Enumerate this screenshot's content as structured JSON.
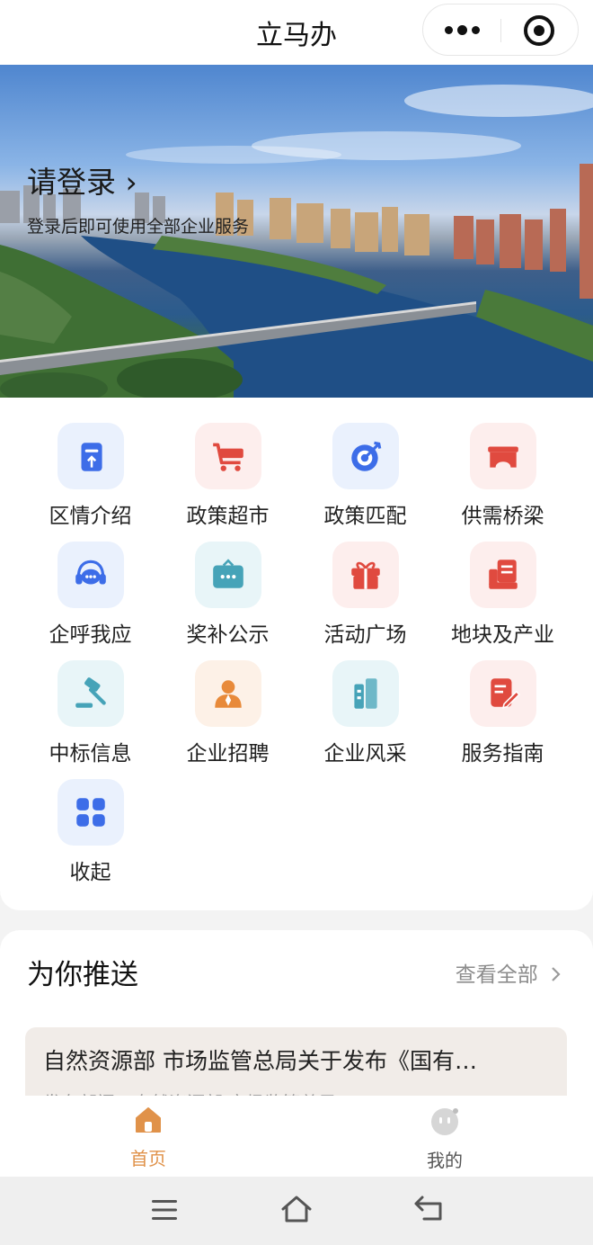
{
  "app": {
    "title": "立马办"
  },
  "hero": {
    "login_label": "请登录",
    "login_chevron": "›",
    "login_sub": "登录后即可使用全部企业服务"
  },
  "services": [
    {
      "label": "区情介绍",
      "icon": "document-upload-icon",
      "color": "#3d6de8",
      "bg": "#eaf1fd"
    },
    {
      "label": "政策超市",
      "icon": "shopping-cart-icon",
      "color": "#e04a3f",
      "bg": "#fdeeed"
    },
    {
      "label": "政策匹配",
      "icon": "target-dart-icon",
      "color": "#3d6de8",
      "bg": "#eaf1fd"
    },
    {
      "label": "供需桥梁",
      "icon": "bridge-icon",
      "color": "#e04a3f",
      "bg": "#fdeeed"
    },
    {
      "label": "企呼我应",
      "icon": "headset-chat-icon",
      "color": "#3d6de8",
      "bg": "#eaf1fd"
    },
    {
      "label": "奖补公示",
      "icon": "bulletin-board-icon",
      "color": "#46a3b8",
      "bg": "#e8f5f8"
    },
    {
      "label": "活动广场",
      "icon": "gift-icon",
      "color": "#e04a3f",
      "bg": "#fdeeed"
    },
    {
      "label": "地块及产业",
      "icon": "register-icon",
      "color": "#e04a3f",
      "bg": "#fdeeed"
    },
    {
      "label": "中标信息",
      "icon": "gavel-icon",
      "color": "#46a3b8",
      "bg": "#e8f5f8"
    },
    {
      "label": "企业招聘",
      "icon": "person-icon",
      "color": "#e88a3a",
      "bg": "#fdf1e7"
    },
    {
      "label": "企业风采",
      "icon": "buildings-icon",
      "color": "#46a3b8",
      "bg": "#e8f5f8"
    },
    {
      "label": "服务指南",
      "icon": "edit-document-icon",
      "color": "#e04a3f",
      "bg": "#fdeeed"
    },
    {
      "label": "收起",
      "icon": "grid-icon",
      "color": "#3d6de8",
      "bg": "#eaf1fd"
    }
  ],
  "recommend": {
    "title": "为你推送",
    "view_all": "查看全部",
    "items": [
      {
        "headline": "自然资源部 市场监管总局关于发布《国有…",
        "meta": "发布部门：自然资源部 市场监管总局"
      }
    ]
  },
  "tabbar": {
    "home": {
      "label": "首页",
      "active_color": "#e0924a"
    },
    "mine": {
      "label": "我的",
      "color": "#555555"
    }
  },
  "colors": {
    "accent": "#e0924a"
  }
}
